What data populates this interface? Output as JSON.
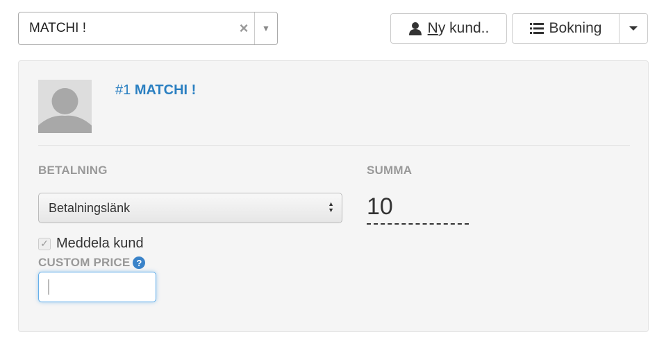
{
  "customer_select": {
    "value": "MATCHI !",
    "clear_symbol": "×"
  },
  "toolbar": {
    "new_customer": {
      "underlined_letter": "N",
      "rest": "y kund..",
      "icon": "user-icon"
    },
    "booking": {
      "label": "Bokning",
      "icon": "list-icon"
    }
  },
  "customer": {
    "number": "#1",
    "name": "MATCHI !"
  },
  "payment": {
    "label": "BETALNING",
    "selected": "Betalningslänk",
    "notify_label": "Meddela kund",
    "notify_checked": true
  },
  "sum": {
    "label": "SUMMA",
    "value": "10"
  },
  "custom_price": {
    "label": "CUSTOM PRICE",
    "value": ""
  },
  "colors": {
    "link_blue": "#2a7fc1",
    "focus_border": "#66afe9",
    "help_icon": "#3a83c9"
  }
}
